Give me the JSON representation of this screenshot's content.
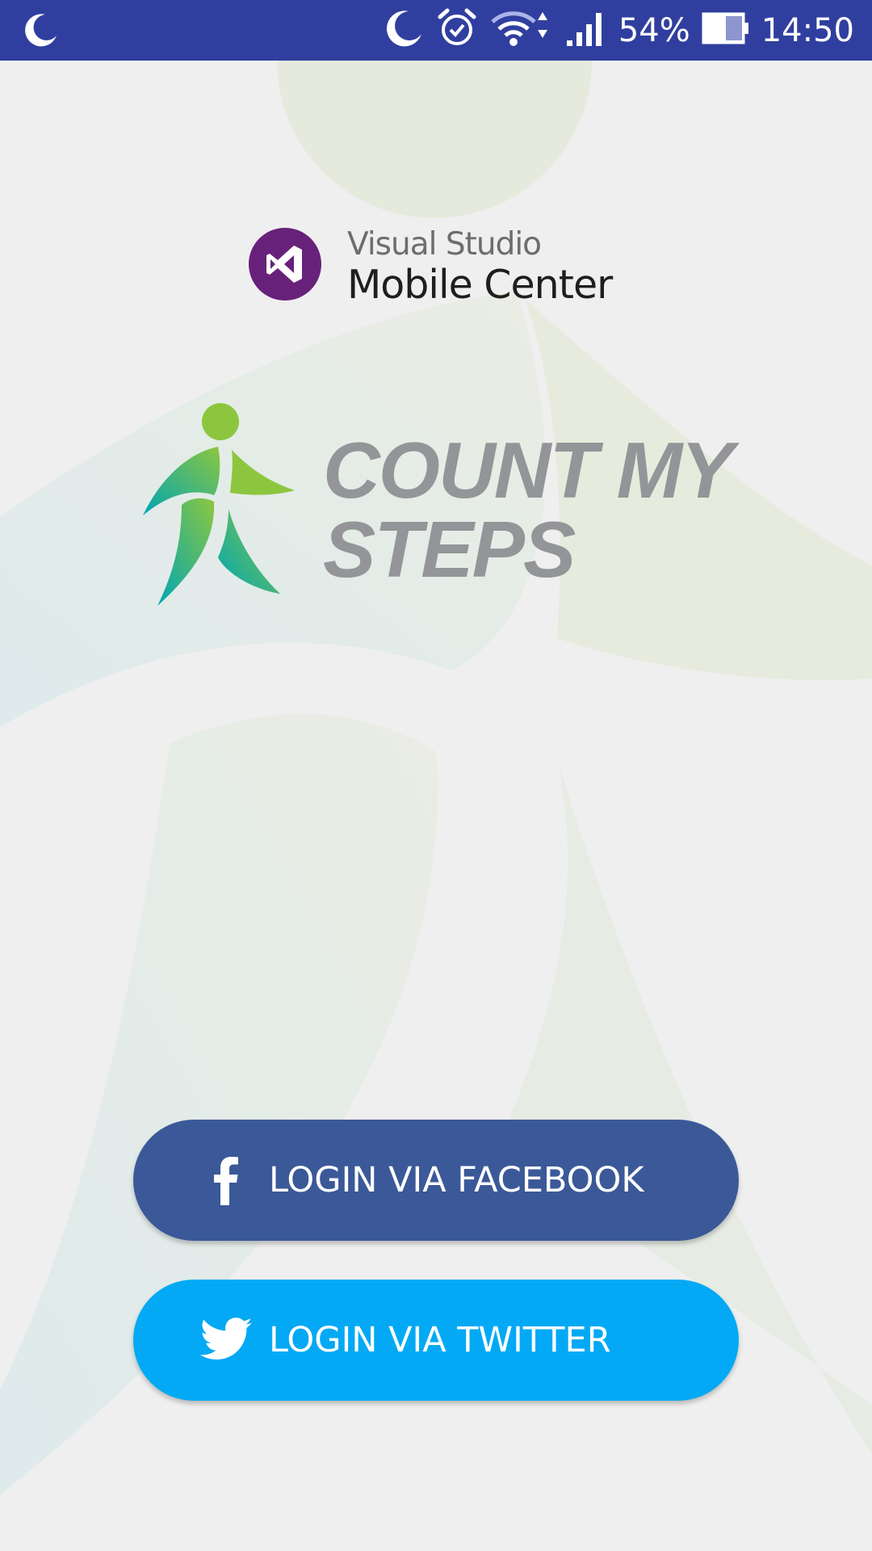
{
  "status_bar": {
    "left_icon": "moon-icon",
    "icons": [
      "moon-icon",
      "alarm-icon",
      "wifi-icon",
      "signal-icon"
    ],
    "battery_percent": "54%",
    "battery_icon": "battery-icon",
    "time": "14:50",
    "background": "#303f9f"
  },
  "branding": {
    "vs_line1": "Visual Studio",
    "vs_line2": "Mobile Center",
    "vs_icon": "visual-studio-icon",
    "vs_color": "#68217a"
  },
  "app": {
    "name_line1": "COUNT MY",
    "name_line2": "STEPS",
    "logo_icon": "walker-icon"
  },
  "buttons": {
    "facebook": {
      "label": "LOGIN VIA FACEBOOK",
      "icon": "facebook-icon",
      "color": "#3b5998"
    },
    "twitter": {
      "label": "LOGIN VIA TWITTER",
      "icon": "twitter-icon",
      "color": "#03a9f4"
    }
  }
}
